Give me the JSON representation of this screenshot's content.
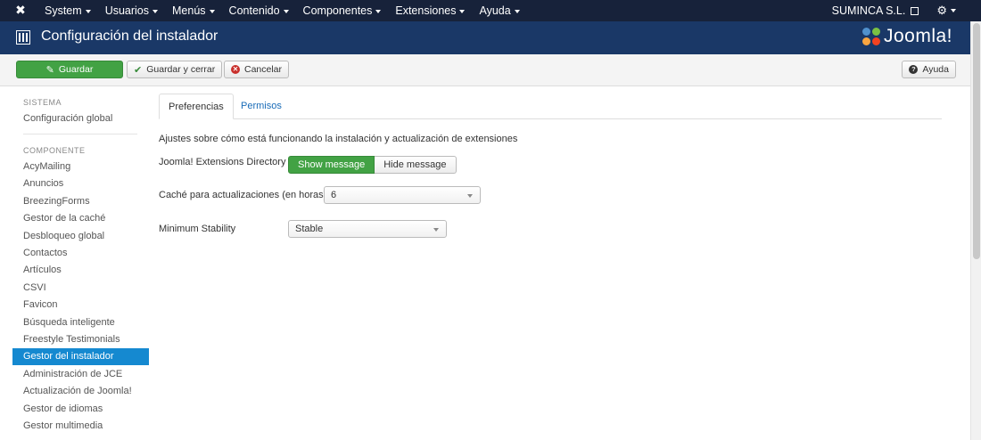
{
  "navbar": {
    "menu": [
      "System",
      "Usuarios",
      "Menús",
      "Contenido",
      "Componentes",
      "Extensiones",
      "Ayuda"
    ],
    "site_name": "SUMINCA S.L."
  },
  "title": {
    "text": "Configuración del instalador",
    "brand": "Joomla!"
  },
  "toolbar": {
    "save": "Guardar",
    "save_close": "Guardar y cerrar",
    "cancel": "Cancelar",
    "help": "Ayuda"
  },
  "sidebar": {
    "section_system": "SISTEMA",
    "global_config": "Configuración global",
    "section_component": "COMPONENTE",
    "items": [
      "AcyMailing",
      "Anuncios",
      "BreezingForms",
      "Gestor de la caché",
      "Desbloqueo global",
      "Contactos",
      "Artículos",
      "CSVI",
      "Favicon",
      "Búsqueda inteligente",
      "Freestyle Testimonials",
      "Gestor del instalador",
      "Administración de JCE",
      "Actualización de Joomla!",
      "Gestor de idiomas",
      "Gestor multimedia"
    ],
    "active_item": "Gestor del instalador"
  },
  "tabs": {
    "preferences": "Preferencias",
    "permissions": "Permisos"
  },
  "form": {
    "description": "Ajustes sobre cómo está funcionando la instalación y actualización de extensiones",
    "jed_label": "Joomla! Extensions Directory",
    "jed_show": "Show message",
    "jed_hide": "Hide message",
    "cache_label": "Caché para actualizaciones (en horas)",
    "cache_value": "6",
    "stability_label": "Minimum Stability",
    "stability_value": "Stable"
  },
  "colors": {
    "navbar": "#17223a",
    "titlebar": "#1a3867",
    "success": "#42a244",
    "active": "#1589d0",
    "link": "#1a6cb8"
  }
}
